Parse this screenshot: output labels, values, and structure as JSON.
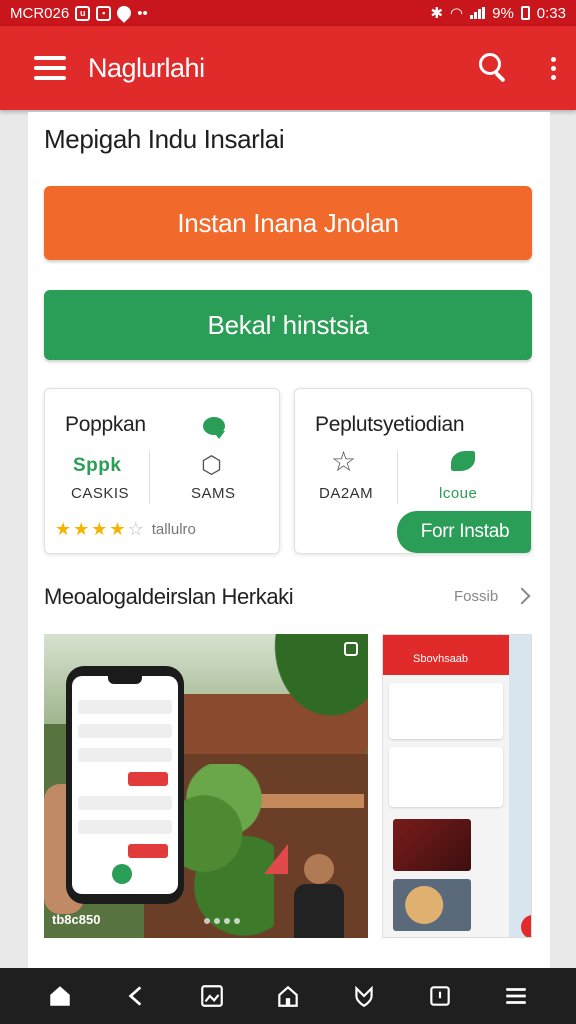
{
  "status_bar": {
    "carrier": "MCR026",
    "battery": "9%",
    "time": "0:33"
  },
  "app_bar": {
    "title": "Naglurlahi"
  },
  "main": {
    "heading": "Mepigah Indu Insarlai",
    "primary_button": "Instan Inana Jnolan",
    "secondary_button": "Bekal' hinstsia",
    "tiles": [
      {
        "title": "Poppkan",
        "stat_left_value": "Sppk",
        "stat_left_label": "CASKIS",
        "stat_right_label": "SAMS",
        "rating_stars": 4,
        "rating_text": "tallulro"
      },
      {
        "title": "Peplutsyetiodian",
        "stat_left_label": "DA2AM",
        "stat_right_label": "lcoue",
        "install_label": "Forr Instab"
      }
    ],
    "section_title": "Meoalogaldeirslan Herkaki",
    "see_all": "Fossib",
    "photo1_caption": "tb8c850",
    "photo2_tab": "Sbovhsaab"
  },
  "bottom_nav": {
    "items": [
      "home-icon",
      "back-icon",
      "gallery-icon",
      "house-outline-icon",
      "shield-icon",
      "square-icon",
      "menu-icon"
    ]
  },
  "colors": {
    "status_bar": "#c8161c",
    "app_bar": "#e12a2a",
    "orange": "#f26a2b",
    "green": "#2a9d56",
    "nav": "#1f1f1f"
  }
}
